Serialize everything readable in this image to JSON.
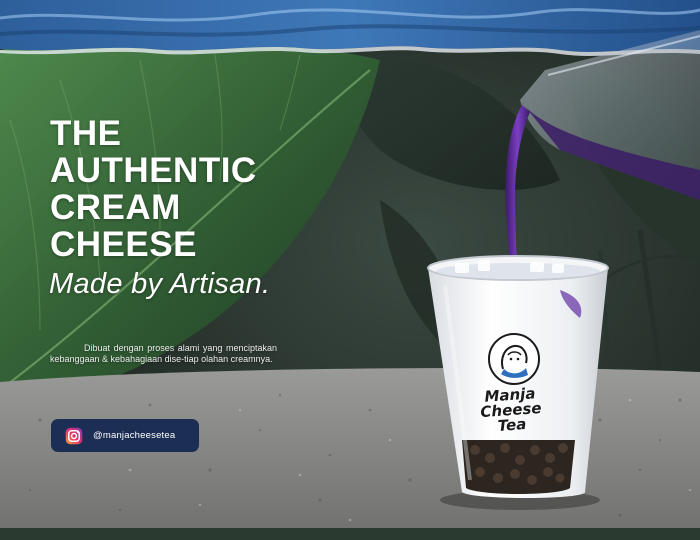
{
  "headline": {
    "line1": "THE",
    "line2": "AUTHENTIC",
    "line3": "CREAM",
    "line4": "CHEESE"
  },
  "tagline": "Made by Artisan.",
  "description": "Dibuat dengan proses alami yang menciptakan kebanggaan & kebahagiaan dise-tiap olahan creamnya.",
  "social": {
    "icon": "instagram-icon",
    "handle": "@manjacheesetea"
  },
  "cup_label": {
    "line1": "Manja",
    "line2": "Cheese",
    "line3": "Tea"
  },
  "colors": {
    "accent_blue": "#1c2e54",
    "purple_tea": "#5a2a8c",
    "leaf_green": "#3c6b3f",
    "text_white": "#ffffff"
  }
}
